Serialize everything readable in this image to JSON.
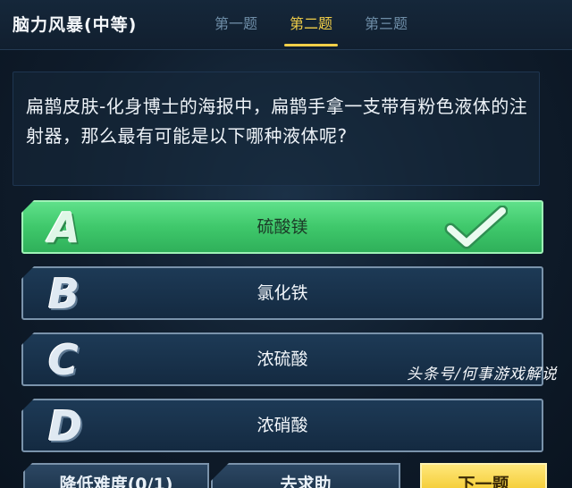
{
  "header": {
    "mode_title": "脑力风暴(中等)",
    "tabs": [
      {
        "label": "第一题",
        "active": false
      },
      {
        "label": "第二题",
        "active": true
      },
      {
        "label": "第三题",
        "active": false
      }
    ]
  },
  "question": {
    "text": "扁鹊皮肤-化身博士的海报中，扁鹊手拿一支带有粉色液体的注射器，那么最有可能是以下哪种液体呢?"
  },
  "options": [
    {
      "letter": "A",
      "label": "硫酸镁",
      "state": "correct"
    },
    {
      "letter": "B",
      "label": "氯化铁",
      "state": "normal"
    },
    {
      "letter": "C",
      "label": "浓硫酸",
      "state": "normal"
    },
    {
      "letter": "D",
      "label": "浓硝酸",
      "state": "normal"
    }
  ],
  "footer": {
    "lower_difficulty": "降低难度(0/1)",
    "ask_help": "去求助",
    "next": "下一题"
  },
  "watermark": "头条号/何事游戏解说",
  "icons": {
    "correct_mark": "check-icon"
  },
  "colors": {
    "accent": "#f2cf48",
    "correct": "#4fd07a",
    "option_bg": "#1a334d",
    "next_button": "#f7d54a"
  }
}
